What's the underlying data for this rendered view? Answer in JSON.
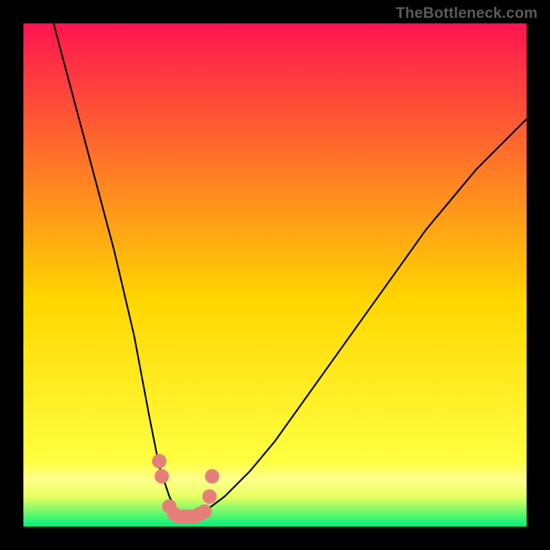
{
  "attribution": "TheBottleneck.com",
  "colors": {
    "gradient_top": "#ff1450",
    "gradient_mid": "#ffd600",
    "gradient_band": "#ffff8c",
    "gradient_bottom": "#00f07a",
    "frame": "#000000",
    "curve": "#000000",
    "points": "#e67f7a"
  },
  "chart_data": {
    "type": "line",
    "title": "",
    "xlabel": "",
    "ylabel": "",
    "xlim": [
      0,
      100
    ],
    "ylim": [
      0,
      100
    ],
    "grid": false,
    "series": [
      {
        "name": "bottleneck-curve",
        "x": [
          6,
          10,
          14,
          18,
          22,
          25,
          27,
          29,
          30.5,
          32,
          34,
          36,
          40,
          45,
          50,
          55,
          60,
          65,
          70,
          75,
          80,
          85,
          90,
          95,
          100
        ],
        "y": [
          100,
          85,
          70,
          55,
          38,
          22,
          12,
          6,
          3,
          2,
          2,
          3,
          6,
          11,
          17,
          24,
          31,
          38,
          45,
          52,
          59,
          65,
          71,
          76,
          81
        ]
      }
    ],
    "points": {
      "name": "highlighted-points",
      "x": [
        27,
        27.5,
        29,
        30,
        31,
        32,
        33,
        34,
        35,
        36,
        37,
        37.5
      ],
      "y": [
        13,
        10,
        4,
        2.5,
        2,
        2,
        2,
        2,
        2.5,
        3,
        6,
        10
      ]
    },
    "annotations": [
      {
        "text": "TheBottleneck.com",
        "position": "top-right"
      }
    ]
  }
}
